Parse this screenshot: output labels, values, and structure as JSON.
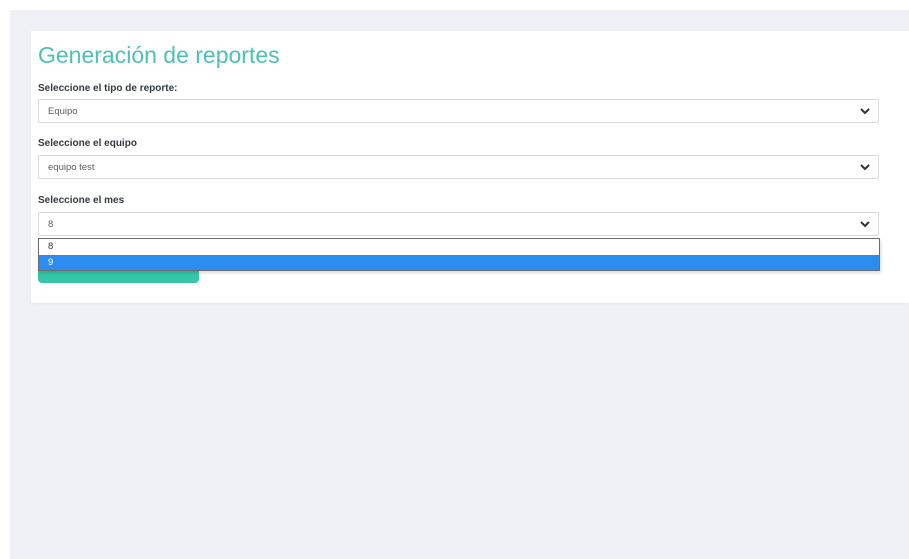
{
  "page": {
    "title": "Generación de reportes"
  },
  "form": {
    "report_type": {
      "label": "Seleccione el tipo de reporte:",
      "value": "Equipo"
    },
    "team": {
      "label": "Seleccione el equipo",
      "value": "equipo test"
    },
    "month": {
      "label": "Seleccione el mes",
      "value": "8",
      "options": [
        "8",
        "9"
      ],
      "highlighted_option": "9",
      "dropdown_open": true
    }
  },
  "icons": {
    "select_arrow": "chevron-down-icon"
  },
  "colors": {
    "background": "#eef0f5",
    "title": "#4fc0b8",
    "button": "#35c7a8",
    "option_highlight": "#2d8cf0"
  }
}
